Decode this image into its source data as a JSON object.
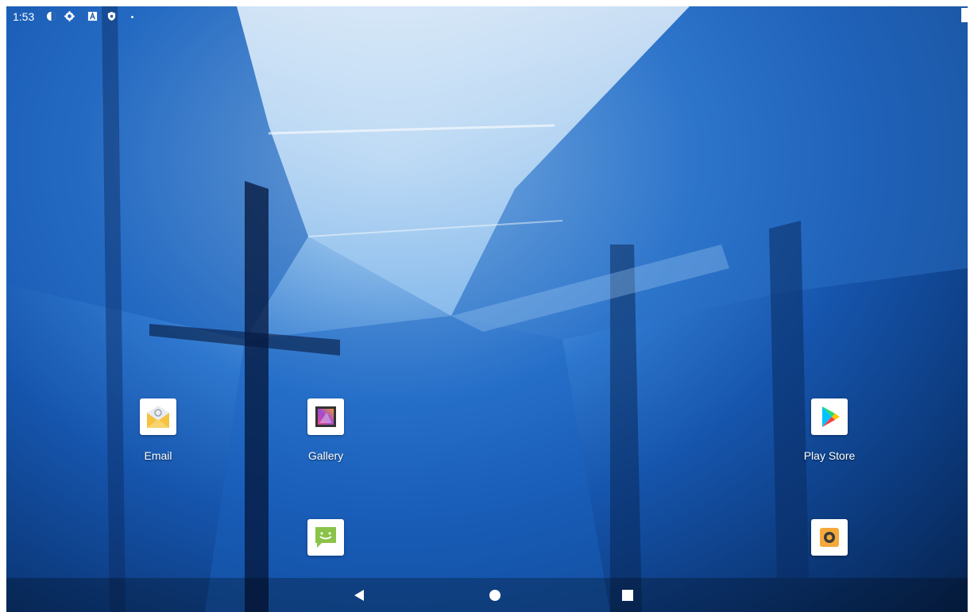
{
  "status_bar": {
    "time": "1:53",
    "icons": [
      "privacy-icon",
      "settings-icon",
      "a-icon",
      "shield-icon",
      "dot-icon"
    ]
  },
  "apps": [
    {
      "label": "Email",
      "icon": "email-icon"
    },
    {
      "label": "Gallery",
      "icon": "gallery-icon"
    },
    {
      "label": "Play Store",
      "icon": "play-store-icon"
    },
    {
      "label": "",
      "icon": "messaging-icon"
    },
    {
      "label": "",
      "icon": "camera-icon"
    }
  ],
  "nav": {
    "buttons": [
      "back-icon",
      "home-icon",
      "recents-icon"
    ]
  },
  "colors": {
    "wallpaper_dark": "#0c3a7d",
    "wallpaper_light": "#cfe3f7",
    "email_yellow": "#f5c242",
    "messaging_green": "#8bc34a",
    "camera_orange": "#f4a93a"
  }
}
